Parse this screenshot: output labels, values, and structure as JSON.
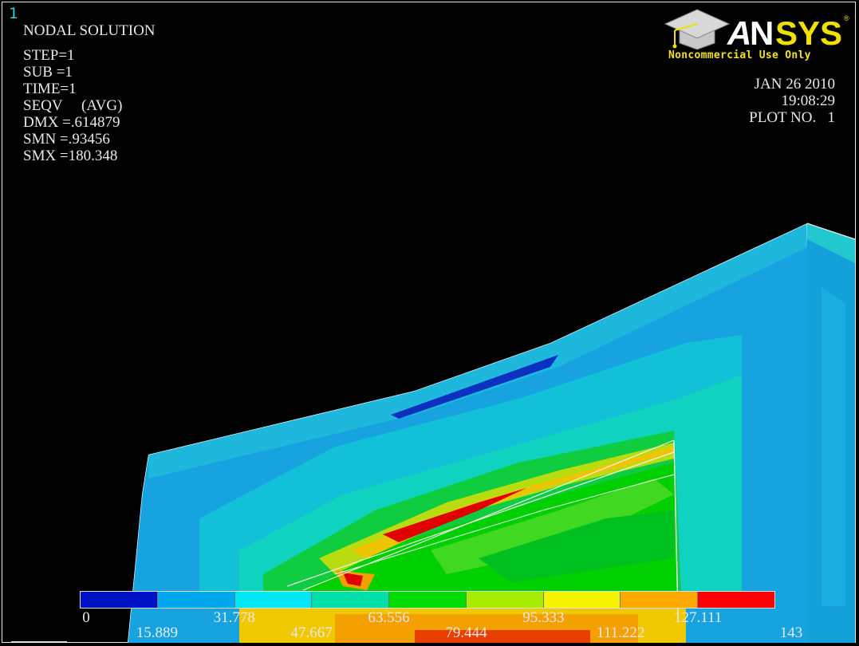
{
  "window_number": "1",
  "solution": {
    "title": "NODAL SOLUTION",
    "step": "STEP=1",
    "sub": "SUB =1",
    "time": "TIME=1",
    "quantity": "SEQV     (AVG)",
    "dmx": "DMX =.614879",
    "smn": "SMN =.93456",
    "smx": "SMX =180.348"
  },
  "logo": {
    "brand": "ANSYS",
    "notice": "Noncommercial Use Only",
    "icon": "graduation-cap-icon"
  },
  "stamp": {
    "date": "JAN 26 2010",
    "time": "19:08:29",
    "plot": "PLOT NO.   1"
  },
  "legend": {
    "colors": [
      "#0012c8",
      "#00a6ee",
      "#00e6f4",
      "#00dfa8",
      "#00dc00",
      "#a6ec00",
      "#f4f400",
      "#ffa800",
      "#ff0000"
    ],
    "upper_labels": [
      "0",
      "31.778",
      "63.556",
      "95.333",
      "127.111"
    ],
    "lower_labels": [
      "15.889",
      "47.667",
      "79.444",
      "111.222",
      "143"
    ]
  }
}
